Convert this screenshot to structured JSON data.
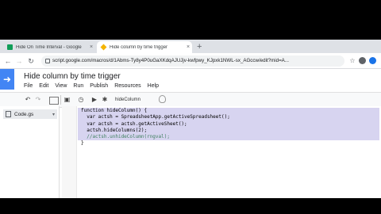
{
  "browser": {
    "tabs": [
      {
        "label": "Hide On Time Interval - Google",
        "close": "×",
        "active": false
      },
      {
        "label": "Hide column by time trigger",
        "close": "×",
        "active": true
      }
    ],
    "new_tab": "+",
    "url": "script.google.com/macros/d/1Abms-Ty8y4P0uGaXKdqAJUJjv-kwfpwy_KJpxk1NWL-sx_AGccw/edit?mid=A..."
  },
  "app": {
    "project_title": "Hide column by time trigger",
    "menu": [
      "File",
      "Edit",
      "View",
      "Run",
      "Publish",
      "Resources",
      "Help"
    ]
  },
  "toolbar": {
    "function_select": "hideColumn",
    "icons": [
      "undo-icon",
      "redo-icon",
      "format-icon",
      "save-icon",
      "trigger-clock-icon",
      "run-icon",
      "debug-icon",
      "lightbulb-icon"
    ]
  },
  "sidebar": {
    "file": "Code.gs",
    "file_arrow": "▾"
  },
  "code": {
    "lines": [
      "function hideColumn() {",
      "  var actsh = SpreadsheetApp.getActiveSpreadsheet();",
      "  var actsh = actsh.getActiveSheet();",
      "  actsh.hideColumns(2);",
      "  //actsh.unhideColumn(rngval);",
      "}"
    ]
  },
  "colors": {
    "accent": "#4285f4",
    "selection": "#d7d4f0",
    "tab_strip": "#dee1e6"
  }
}
